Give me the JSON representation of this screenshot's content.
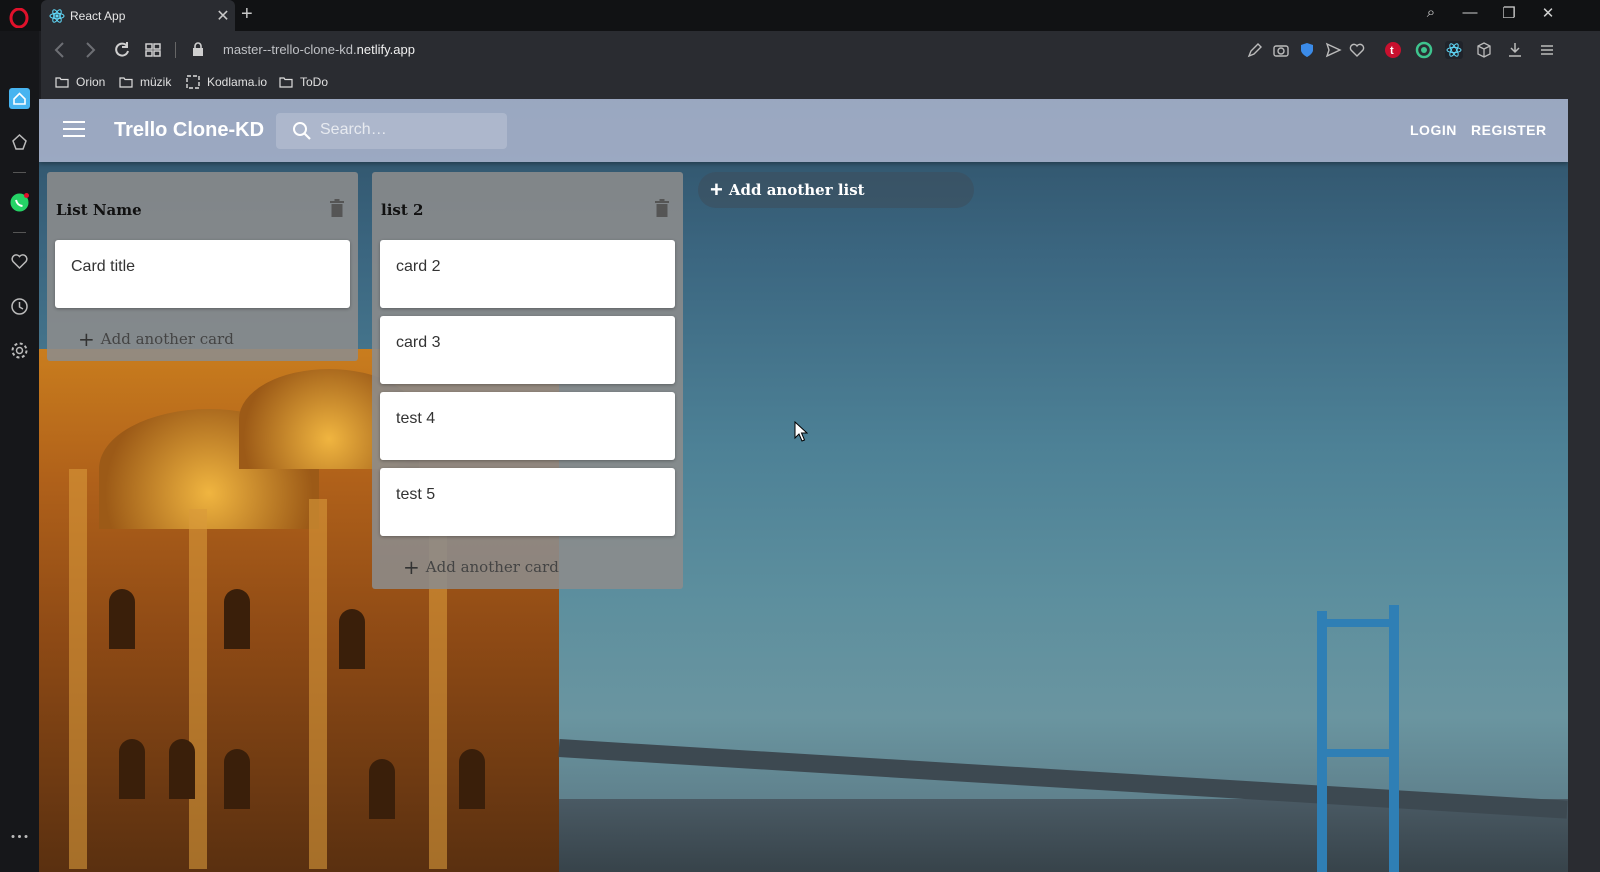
{
  "browser": {
    "tab_title": "React App",
    "tab_close": "✕",
    "new_tab": "+",
    "url_prefix": "master--trello-clone-kd.",
    "url_domain": "netlify.app",
    "bookmarks": [
      "Orion",
      "müzik",
      "Kodlama.io",
      "ToDo"
    ],
    "window_controls": {
      "search": "⌕",
      "minimize": "—",
      "restore": "❐",
      "close": "✕"
    }
  },
  "app": {
    "title": "Trello Clone-KD",
    "search_placeholder": "Search…",
    "login": "LOGIN",
    "register": "REGISTER",
    "add_list": "Add another list",
    "add_card": "Add another card",
    "lists": [
      {
        "title": "List Name",
        "cards": [
          "Card title"
        ]
      },
      {
        "title": "list 2",
        "cards": [
          "card 2",
          "card 3",
          "test 4",
          "test 5"
        ]
      }
    ]
  },
  "icons": {
    "tab_favicon": "react-icon",
    "search": "search-icon",
    "delete": "trash-icon",
    "menu": "hamburger-icon"
  },
  "colors": {
    "appbar": "#aab4cd",
    "list_bg": "#8c8c8c",
    "card_bg": "#ffffff",
    "opera_red": "#e0112b"
  }
}
